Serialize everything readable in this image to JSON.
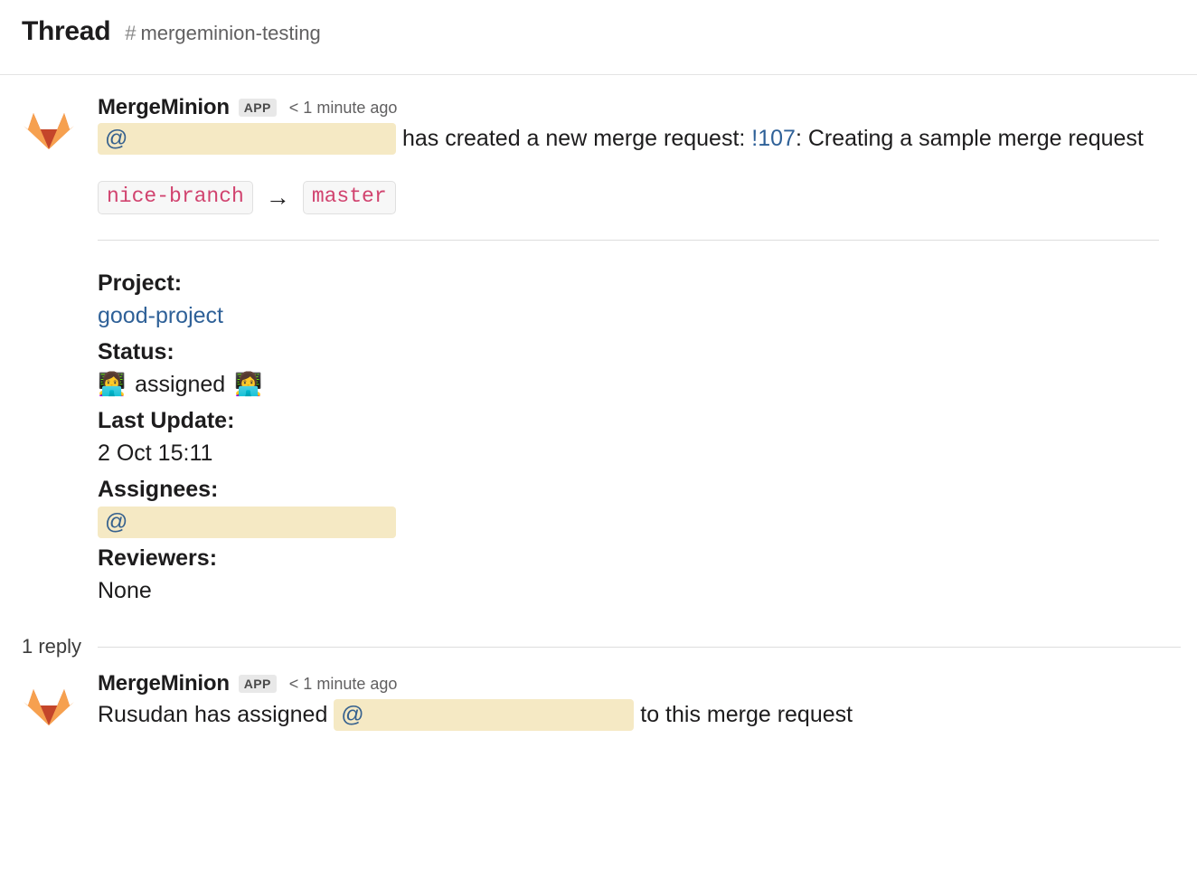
{
  "header": {
    "title": "Thread",
    "hash_icon": "hash-icon",
    "channel": "mergeminion-testing"
  },
  "messages": [
    {
      "avatar_icon": "gitlab-tanuki-logo",
      "sender": "MergeMinion",
      "badge": "APP",
      "timestamp": "< 1 minute ago",
      "mention_at": "@",
      "text_after_mention": "has created a new merge request: ",
      "mr_link": "!107",
      "text_tail": ": Creating a sample merge request",
      "branches": {
        "source": "nice-branch",
        "arrow": "→",
        "target": "master"
      },
      "fields": {
        "project_label": "Project:",
        "project_value": "good-project",
        "status_label": "Status:",
        "status_emoji_left": "👩‍💻",
        "status_value": "assigned",
        "status_emoji_right": "👩‍💻",
        "last_update_label": "Last Update:",
        "last_update_value": "2 Oct 15:11",
        "assignees_label": "Assignees:",
        "assignees_mention": "@",
        "reviewers_label": "Reviewers:",
        "reviewers_value": "None"
      }
    }
  ],
  "reply_separator": {
    "count_label": "1 reply"
  },
  "reply": {
    "avatar_icon": "gitlab-tanuki-logo",
    "sender": "MergeMinion",
    "badge": "APP",
    "timestamp": "< 1 minute ago",
    "text_before": "Rusudan has assigned ",
    "mention_at": "@",
    "text_after": "to this merge request"
  },
  "colors": {
    "mention_bg": "#f5e9c4",
    "mention_fg": "#36618e",
    "link": "#2f6198",
    "code_chip_fg": "#d1436f",
    "gitlab_dark_orange": "#c4452a",
    "gitlab_mid_orange": "#e8763a",
    "gitlab_light_orange": "#f6a04f",
    "divider": "#dddddd",
    "text": "#1d1c1d",
    "muted_text": "#616061"
  }
}
